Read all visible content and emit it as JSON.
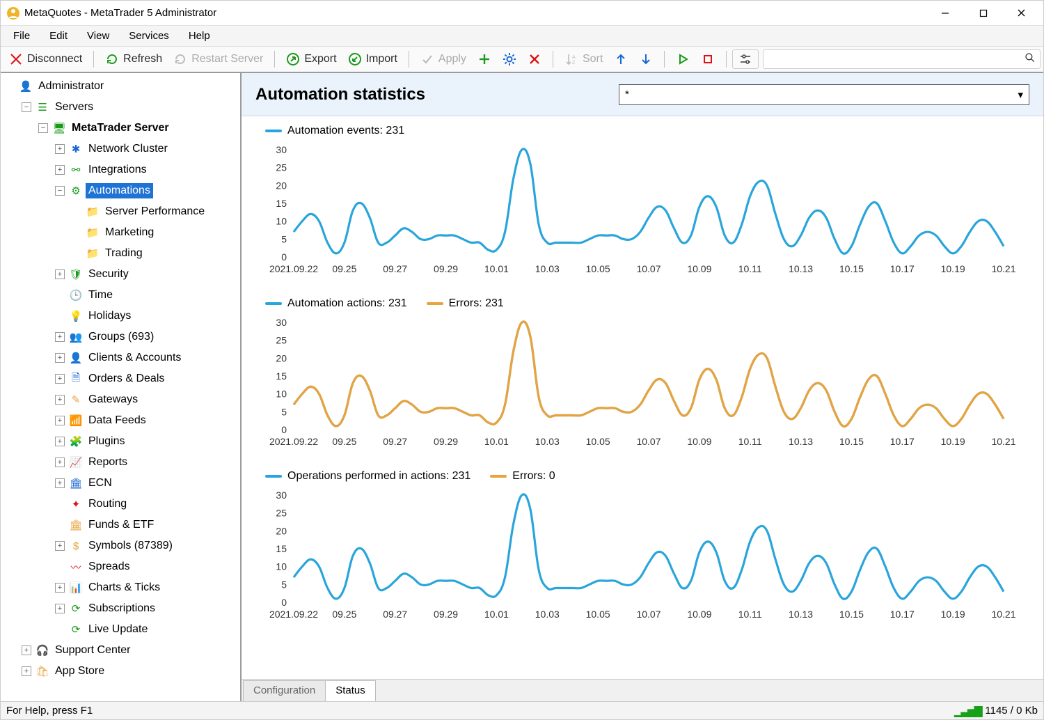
{
  "titlebar": {
    "title": "MetaQuotes - MetaTrader 5 Administrator"
  },
  "menu": {
    "file": "File",
    "edit": "Edit",
    "view": "View",
    "services": "Services",
    "help": "Help"
  },
  "toolbar": {
    "disconnect": "Disconnect",
    "refresh": "Refresh",
    "restart": "Restart Server",
    "export": "Export",
    "import": "Import",
    "apply": "Apply",
    "sort": "Sort"
  },
  "tree": {
    "administrator": "Administrator",
    "servers": "Servers",
    "metatrader_server": "MetaTrader Server",
    "network_cluster": "Network Cluster",
    "integrations": "Integrations",
    "automations": "Automations",
    "server_performance": "Server Performance",
    "marketing": "Marketing",
    "trading": "Trading",
    "security": "Security",
    "time": "Time",
    "holidays": "Holidays",
    "groups": "Groups (693)",
    "clients": "Clients & Accounts",
    "orders": "Orders & Deals",
    "gateways": "Gateways",
    "data_feeds": "Data Feeds",
    "plugins": "Plugins",
    "reports": "Reports",
    "ecn": "ECN",
    "routing": "Routing",
    "funds_etf": "Funds & ETF",
    "symbols": "Symbols (87389)",
    "spreads": "Spreads",
    "charts_ticks": "Charts & Ticks",
    "subscriptions": "Subscriptions",
    "live_update": "Live Update",
    "support_center": "Support Center",
    "app_store": "App Store"
  },
  "page": {
    "title": "Automation statistics",
    "filter_value": "*"
  },
  "tabs": {
    "configuration": "Configuration",
    "status": "Status"
  },
  "status": {
    "help": "For Help, press F1",
    "net": "1145 / 0 Kb"
  },
  "chart_data": [
    {
      "type": "line",
      "title": "",
      "series": [
        {
          "name": "Automation events: 231",
          "color": "#29a5db",
          "values": [
            7,
            10,
            12,
            10,
            4,
            1,
            4,
            13,
            15,
            11,
            4,
            4,
            6,
            8,
            7,
            5,
            5,
            6,
            6,
            6,
            5,
            4,
            4,
            2,
            2,
            7,
            22,
            30,
            26,
            9,
            4,
            4,
            4,
            4,
            4,
            5,
            6,
            6,
            6,
            5,
            5,
            7,
            11,
            14,
            13,
            8,
            4,
            6,
            14,
            17,
            14,
            6,
            4,
            9,
            17,
            21,
            20,
            12,
            5,
            3,
            6,
            11,
            13,
            11,
            5,
            1,
            3,
            9,
            14,
            15,
            10,
            4,
            1,
            3,
            6,
            7,
            6,
            3,
            1,
            3,
            7,
            10,
            10,
            7,
            3
          ]
        }
      ],
      "ylim": [
        0,
        30
      ],
      "ylabels": [
        0,
        5,
        10,
        15,
        20,
        25,
        30
      ],
      "xlabels": [
        "2021.09.22",
        "09.25",
        "09.27",
        "09.29",
        "10.01",
        "10.03",
        "10.05",
        "10.07",
        "10.09",
        "10.11",
        "10.13",
        "10.15",
        "10.17",
        "10.19",
        "10.21"
      ]
    },
    {
      "type": "line",
      "title": "",
      "series": [
        {
          "name": "Automation actions: 231",
          "color": "#29a5db",
          "values": [
            7,
            10,
            12,
            10,
            4,
            1,
            4,
            13,
            15,
            11,
            4,
            4,
            6,
            8,
            7,
            5,
            5,
            6,
            6,
            6,
            5,
            4,
            4,
            2,
            2,
            7,
            22,
            30,
            26,
            9,
            4,
            4,
            4,
            4,
            4,
            5,
            6,
            6,
            6,
            5,
            5,
            7,
            11,
            14,
            13,
            8,
            4,
            6,
            14,
            17,
            14,
            6,
            4,
            9,
            17,
            21,
            20,
            12,
            5,
            3,
            6,
            11,
            13,
            11,
            5,
            1,
            3,
            9,
            14,
            15,
            10,
            4,
            1,
            3,
            6,
            7,
            6,
            3,
            1,
            3,
            7,
            10,
            10,
            7,
            3
          ]
        },
        {
          "name": "Errors: 231",
          "color": "#e8a33d",
          "values": [
            7,
            10,
            12,
            10,
            4,
            1,
            4,
            13,
            15,
            11,
            4,
            4,
            6,
            8,
            7,
            5,
            5,
            6,
            6,
            6,
            5,
            4,
            4,
            2,
            2,
            7,
            22,
            30,
            26,
            9,
            4,
            4,
            4,
            4,
            4,
            5,
            6,
            6,
            6,
            5,
            5,
            7,
            11,
            14,
            13,
            8,
            4,
            6,
            14,
            17,
            14,
            6,
            4,
            9,
            17,
            21,
            20,
            12,
            5,
            3,
            6,
            11,
            13,
            11,
            5,
            1,
            3,
            9,
            14,
            15,
            10,
            4,
            1,
            3,
            6,
            7,
            6,
            3,
            1,
            3,
            7,
            10,
            10,
            7,
            3
          ]
        }
      ],
      "ylim": [
        0,
        30
      ],
      "ylabels": [
        0,
        5,
        10,
        15,
        20,
        25,
        30
      ],
      "xlabels": [
        "2021.09.22",
        "09.25",
        "09.27",
        "09.29",
        "10.01",
        "10.03",
        "10.05",
        "10.07",
        "10.09",
        "10.11",
        "10.13",
        "10.15",
        "10.17",
        "10.19",
        "10.21"
      ]
    },
    {
      "type": "line",
      "title": "",
      "series": [
        {
          "name": "Operations performed in actions: 231",
          "color": "#29a5db",
          "values": [
            7,
            10,
            12,
            10,
            4,
            1,
            4,
            13,
            15,
            11,
            4,
            4,
            6,
            8,
            7,
            5,
            5,
            6,
            6,
            6,
            5,
            4,
            4,
            2,
            2,
            7,
            22,
            30,
            26,
            9,
            4,
            4,
            4,
            4,
            4,
            5,
            6,
            6,
            6,
            5,
            5,
            7,
            11,
            14,
            13,
            8,
            4,
            6,
            14,
            17,
            14,
            6,
            4,
            9,
            17,
            21,
            20,
            12,
            5,
            3,
            6,
            11,
            13,
            11,
            5,
            1,
            3,
            9,
            14,
            15,
            10,
            4,
            1,
            3,
            6,
            7,
            6,
            3,
            1,
            3,
            7,
            10,
            10,
            7,
            3
          ]
        },
        {
          "name": "Errors: 0",
          "color": "#e8a33d",
          "values": []
        }
      ],
      "ylim": [
        0,
        30
      ],
      "ylabels": [
        0,
        5,
        10,
        15,
        20,
        25,
        30
      ],
      "xlabels": [
        "2021.09.22",
        "09.25",
        "09.27",
        "09.29",
        "10.01",
        "10.03",
        "10.05",
        "10.07",
        "10.09",
        "10.11",
        "10.13",
        "10.15",
        "10.17",
        "10.19",
        "10.21"
      ]
    }
  ]
}
